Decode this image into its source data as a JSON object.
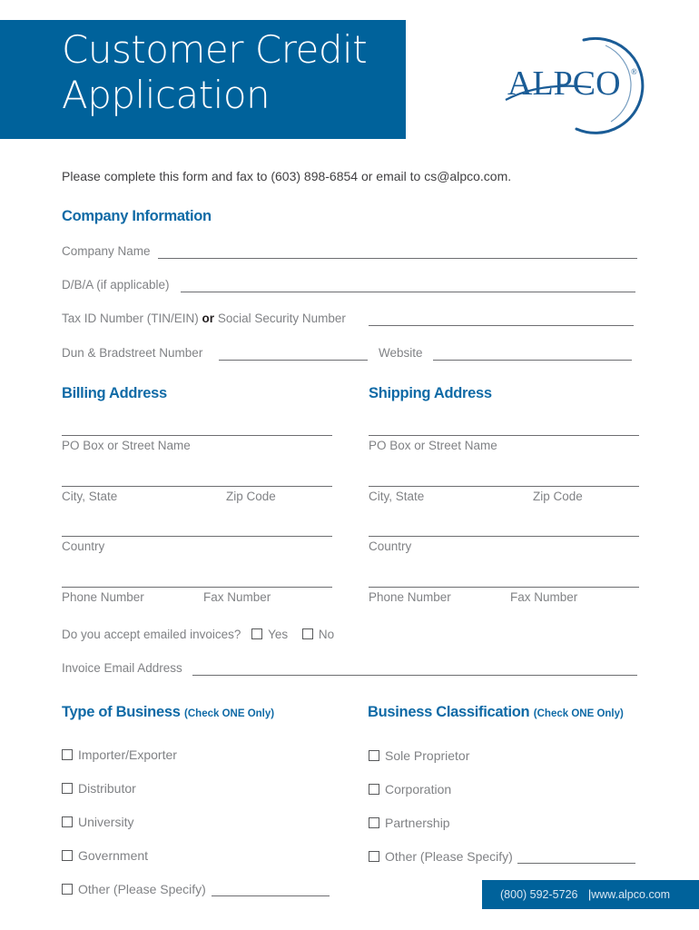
{
  "header": {
    "title_line1": "Customer Credit",
    "title_line2": "Application",
    "logo_text": "ALPCO",
    "logo_mark": "®"
  },
  "intro": "Please complete this form and fax to (603) 898-6854 or email to cs@alpco.com.",
  "company_info": {
    "heading": "Company Information",
    "company_name": "Company Name",
    "dba": "D/B/A (if applicable)",
    "tax_id_prefix": "Tax ID Number (TIN/EIN)",
    "tax_id_or": "or",
    "tax_id_suffix": "Social Security Number",
    "duns": "Dun & Bradstreet Number",
    "website": "Website"
  },
  "billing": {
    "heading": "Billing Address",
    "street": "PO Box or Street Name",
    "city_state": "City, State",
    "zip": "Zip Code",
    "country": "Country",
    "phone": "Phone Number",
    "fax": "Fax Number"
  },
  "shipping": {
    "heading": "Shipping Address",
    "street": "PO Box or Street Name",
    "city_state": "City, State",
    "zip": "Zip Code",
    "country": "Country",
    "phone": "Phone Number",
    "fax": "Fax Number"
  },
  "invoices": {
    "question": "Do you accept emailed invoices?",
    "yes": "Yes",
    "no": "No",
    "email_label": "Invoice Email Address"
  },
  "type_of_business": {
    "heading": "Type of Business",
    "sub": "(Check ONE Only)",
    "options": [
      "Importer/Exporter",
      "Distributor",
      "University",
      "Government",
      "Other (Please Specify)"
    ]
  },
  "business_classification": {
    "heading": "Business Classification",
    "sub": "(Check ONE Only)",
    "options": [
      "Sole Proprietor",
      "Corporation",
      "Partnership",
      "Other (Please Specify)"
    ]
  },
  "footer": {
    "phone": "(800) 592-5726",
    "separator": "|",
    "website": "www.alpco.com"
  },
  "colors": {
    "brand_blue": "#00629b",
    "heading_blue": "#0f6aa6"
  }
}
